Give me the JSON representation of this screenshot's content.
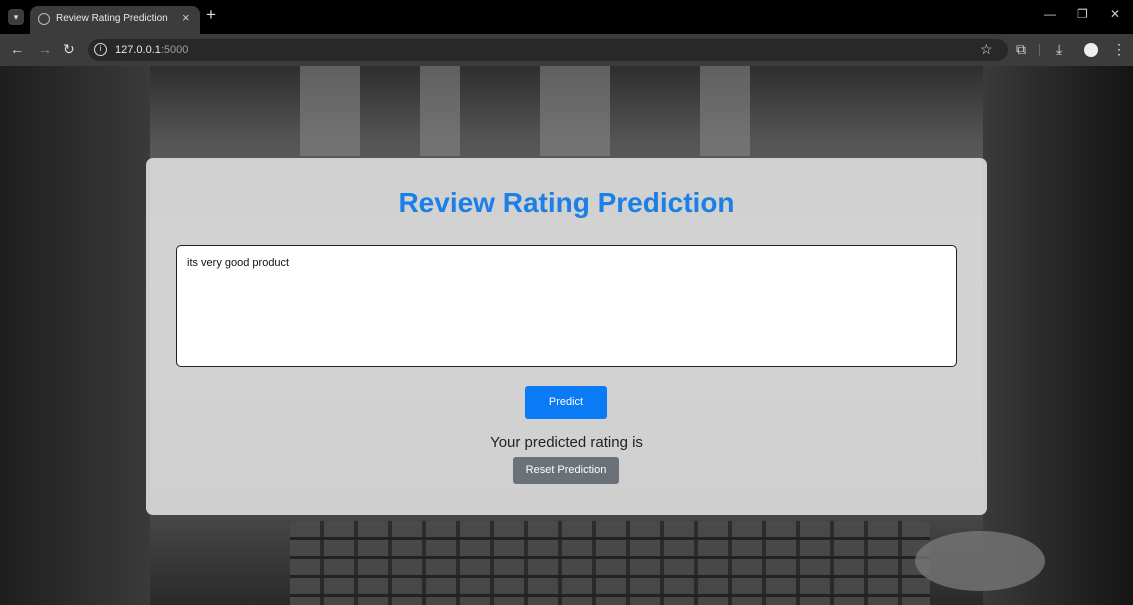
{
  "browser": {
    "tab_title": "Review Rating Prediction",
    "url_host": "127.0.0.1",
    "url_port": ":5000"
  },
  "page": {
    "heading": "Review Rating Prediction",
    "review_text": "its very good product",
    "predict_label": "Predict",
    "result_text": "Your predicted rating is",
    "reset_label": "Reset Prediction"
  },
  "colors": {
    "heading": "#1a7fe6",
    "predict_button": "#0a7bf5",
    "reset_button": "#6b7179"
  }
}
